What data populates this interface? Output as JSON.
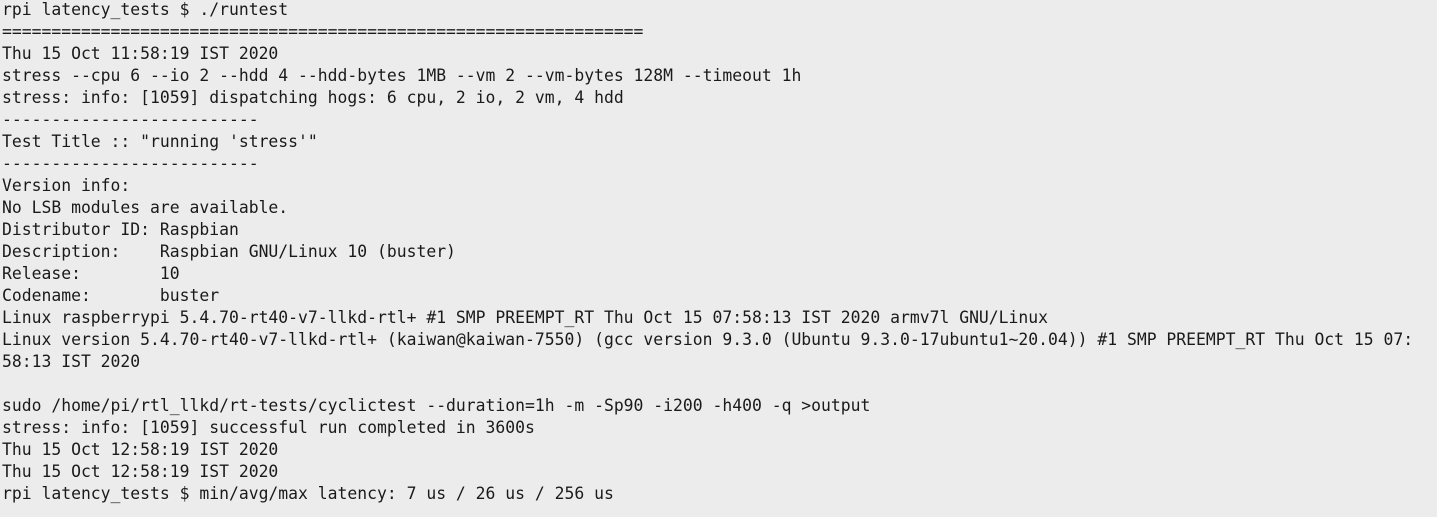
{
  "terminal": {
    "lines": [
      "rpi latency_tests $ ./runtest",
      "=================================================================",
      "Thu 15 Oct 11:58:19 IST 2020",
      "stress --cpu 6 --io 2 --hdd 4 --hdd-bytes 1MB --vm 2 --vm-bytes 128M --timeout 1h",
      "stress: info: [1059] dispatching hogs: 6 cpu, 2 io, 2 vm, 4 hdd",
      "--------------------------",
      "Test Title :: \"running 'stress'\"",
      "--------------------------",
      "Version info:",
      "No LSB modules are available.",
      "Distributor ID: Raspbian",
      "Description:    Raspbian GNU/Linux 10 (buster)",
      "Release:        10",
      "Codename:       buster",
      "Linux raspberrypi 5.4.70-rt40-v7-llkd-rtl+ #1 SMP PREEMPT_RT Thu Oct 15 07:58:13 IST 2020 armv7l GNU/Linux",
      "Linux version 5.4.70-rt40-v7-llkd-rtl+ (kaiwan@kaiwan-7550) (gcc version 9.3.0 (Ubuntu 9.3.0-17ubuntu1~20.04)) #1 SMP PREEMPT_RT Thu Oct 15 07:",
      "58:13 IST 2020",
      "",
      "sudo /home/pi/rtl_llkd/rt-tests/cyclictest --duration=1h -m -Sp90 -i200 -h400 -q >output",
      "stress: info: [1059] successful run completed in 3600s",
      "Thu 15 Oct 12:58:19 IST 2020",
      "Thu 15 Oct 12:58:19 IST 2020",
      "rpi latency_tests $ min/avg/max latency: 7 us / 26 us / 256 us"
    ]
  },
  "colors": {
    "background": "#ececec",
    "foreground": "#1a1a1a"
  }
}
